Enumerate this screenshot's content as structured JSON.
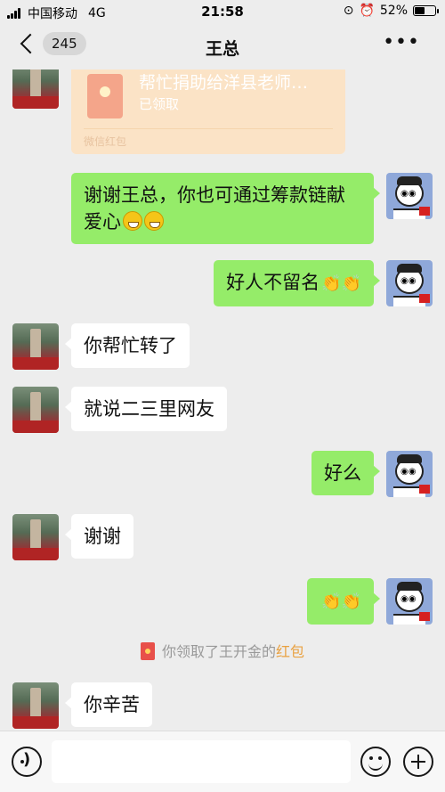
{
  "status_bar": {
    "carrier": "中国移动",
    "network": "4G",
    "time": "21:58",
    "battery": "52%",
    "battery_level": 0.52
  },
  "nav": {
    "back_count": "245",
    "title": "王总",
    "more": "•••"
  },
  "messages": [
    {
      "side": "left",
      "type": "red_packet",
      "title": "帮忙捐助给洋县老师…",
      "status": "已领取",
      "footer": "微信红包"
    },
    {
      "side": "right",
      "text_line1": "谢谢王总，你也可通过筹款链献",
      "text_line2": "爱心"
    },
    {
      "side": "right",
      "text": "好人不留名"
    },
    {
      "side": "left",
      "text": "你帮忙转了"
    },
    {
      "side": "left",
      "text": "就说二三里网友"
    },
    {
      "side": "right",
      "text": "好么"
    },
    {
      "side": "left",
      "text": "谢谢"
    },
    {
      "side": "right",
      "text": ""
    },
    {
      "side": "system",
      "prefix": "你领取了王开金的",
      "highlight": "红包"
    },
    {
      "side": "left",
      "text": "你辛苦"
    }
  ],
  "icons": {
    "back": "chevron-left-icon",
    "more": "more-icon",
    "voice": "voice-icon",
    "emoji": "emoji-icon",
    "plus": "plus-icon",
    "emoji_grin": "grinning-emoji-icon",
    "clap": "applause-emoji-icon"
  },
  "colors": {
    "background": "#ededed",
    "my_bubble": "#95ec69",
    "their_bubble": "#ffffff",
    "red_packet": "#fbe3c6",
    "highlight": "#e9a141"
  }
}
